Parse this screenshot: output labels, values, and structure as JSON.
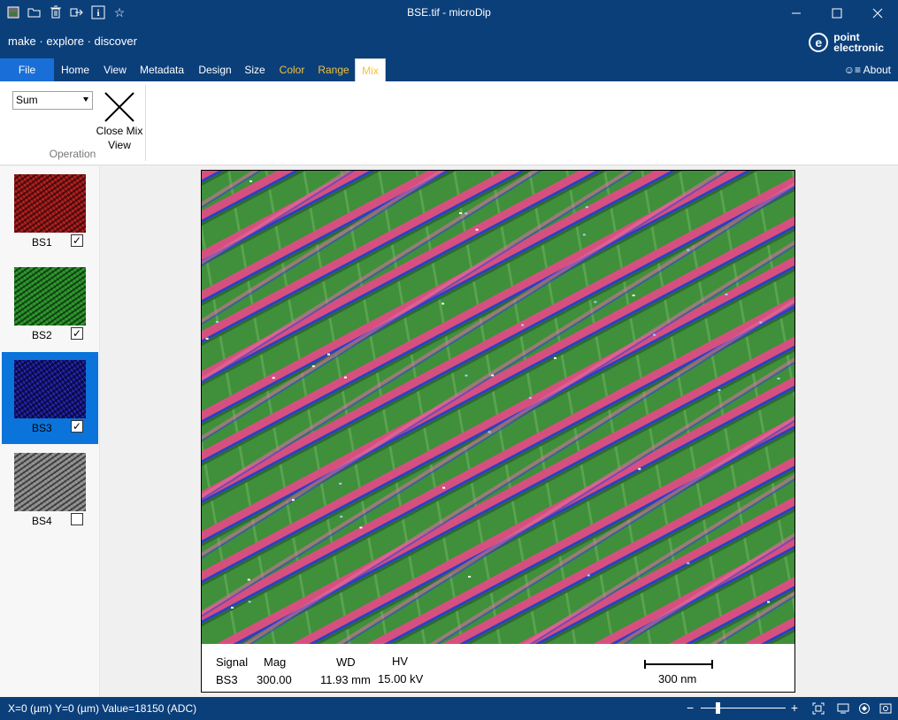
{
  "window": {
    "title": "BSE.tif - microDip",
    "quick_access": [
      "image-icon",
      "open-folder-icon",
      "trash-icon",
      "export-icon",
      "info-icon",
      "star-icon"
    ]
  },
  "brand": {
    "tagline": "make · explore · discover",
    "logo_line1": "point",
    "logo_line2": "electronic"
  },
  "tabs": [
    {
      "label": "File"
    },
    {
      "label": "Home"
    },
    {
      "label": "View"
    },
    {
      "label": "Metadata"
    },
    {
      "label": "Design"
    },
    {
      "label": "Size"
    },
    {
      "label": "Color"
    },
    {
      "label": "Range"
    },
    {
      "label": "Mix"
    }
  ],
  "about_label": "About",
  "ribbon": {
    "operation_value": "Sum",
    "close_mix_label_1": "Close Mix",
    "close_mix_label_2": "View",
    "group_label": "Operation"
  },
  "channels": [
    {
      "label": "BS1",
      "checked": true,
      "color": "#9a1010"
    },
    {
      "label": "BS2",
      "checked": true,
      "color": "#1f8a1f"
    },
    {
      "label": "BS3",
      "checked": true,
      "color": "#10108a",
      "selected": true
    },
    {
      "label": "BS4",
      "checked": false,
      "color": "#8a8a8a"
    }
  ],
  "databar": {
    "signal_label": "Signal",
    "signal_value": "BS3",
    "mag_label": "Mag",
    "mag_value": "300.00",
    "wd_label": "WD",
    "wd_value": "11.93 mm",
    "hv_label": "HV",
    "hv_value": "15.00 kV",
    "scale_label": "300 nm"
  },
  "status": {
    "text": "X=0 (µm)   Y=0 (µm)   Value=18150 (ADC)",
    "zoom_level": 0.2
  },
  "colors": {
    "chrome": "#0b3f7a",
    "file_tab": "#1a6ed8",
    "accent_tab": "#f4c23a",
    "selected": "#0a74da"
  }
}
